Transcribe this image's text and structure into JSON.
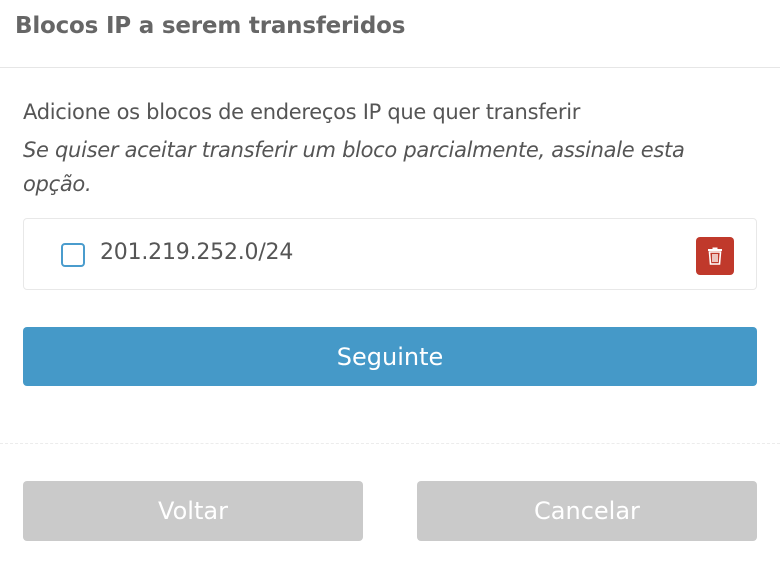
{
  "dialog": {
    "title": "Blocos IP a serem transferidos"
  },
  "main": {
    "intro": "Adicione os blocos de endereços IP que quer transferir",
    "hint": "Se quiser aceitar transferir um bloco parcialmente, assinale esta opção.",
    "blocks": [
      {
        "ip": "201.219.252.0/24",
        "partial": false
      }
    ],
    "next_label": "Seguinte"
  },
  "footer": {
    "back_label": "Voltar",
    "cancel_label": "Cancelar"
  },
  "colors": {
    "primary": "#4599c8",
    "danger": "#c0392b",
    "disabled": "#cacaca"
  },
  "icons": {
    "delete": "trash-icon"
  }
}
